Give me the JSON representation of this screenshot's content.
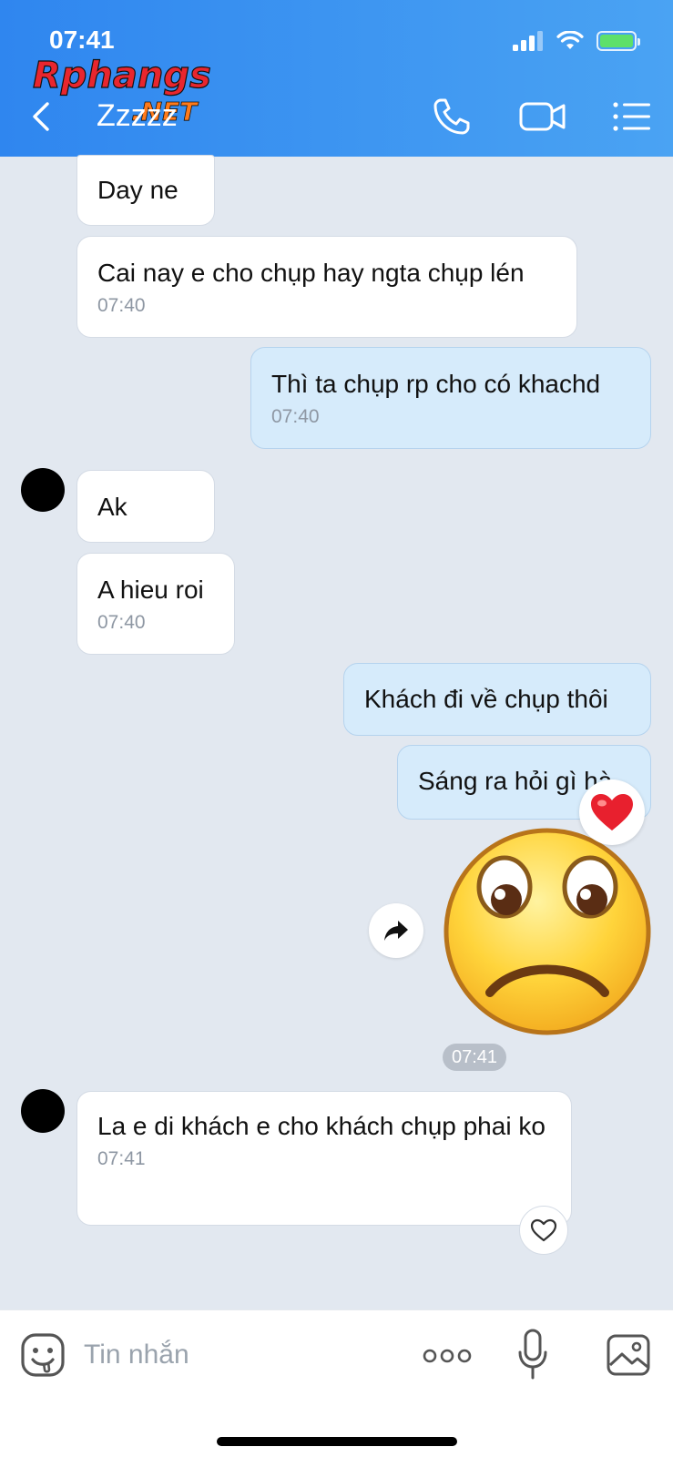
{
  "status_bar": {
    "time": "07:41"
  },
  "watermark": {
    "text_main": "Rphangs",
    "text_sub": ".NET"
  },
  "header": {
    "title": "Zzzzz"
  },
  "messages": [
    {
      "text": "Day ne"
    },
    {
      "text": "Cai nay e cho chụp hay ngta chụp lén",
      "time": "07:40"
    },
    {
      "text": "Thì ta chụp rp cho có khachd",
      "time": "07:40"
    },
    {
      "text": "Ak"
    },
    {
      "text": "A hieu roi",
      "time": "07:40"
    },
    {
      "text": "Khách đi về chụp thôi"
    },
    {
      "text": "Sáng ra hỏi gì hà"
    },
    {
      "text": "La e di khách e cho khách chụp phai ko",
      "time": "07:41"
    }
  ],
  "sticker": {
    "icon": "sad-face-sticker",
    "reaction": "heart"
  },
  "time_divider": "07:41",
  "composer": {
    "placeholder": "Tin nhắn"
  },
  "colors": {
    "header_start": "#2f86ef",
    "header_end": "#4aa3f3",
    "chat_bg": "#e2e8f0",
    "my_bubble": "#d6ebfb",
    "their_bubble": "#ffffff"
  }
}
